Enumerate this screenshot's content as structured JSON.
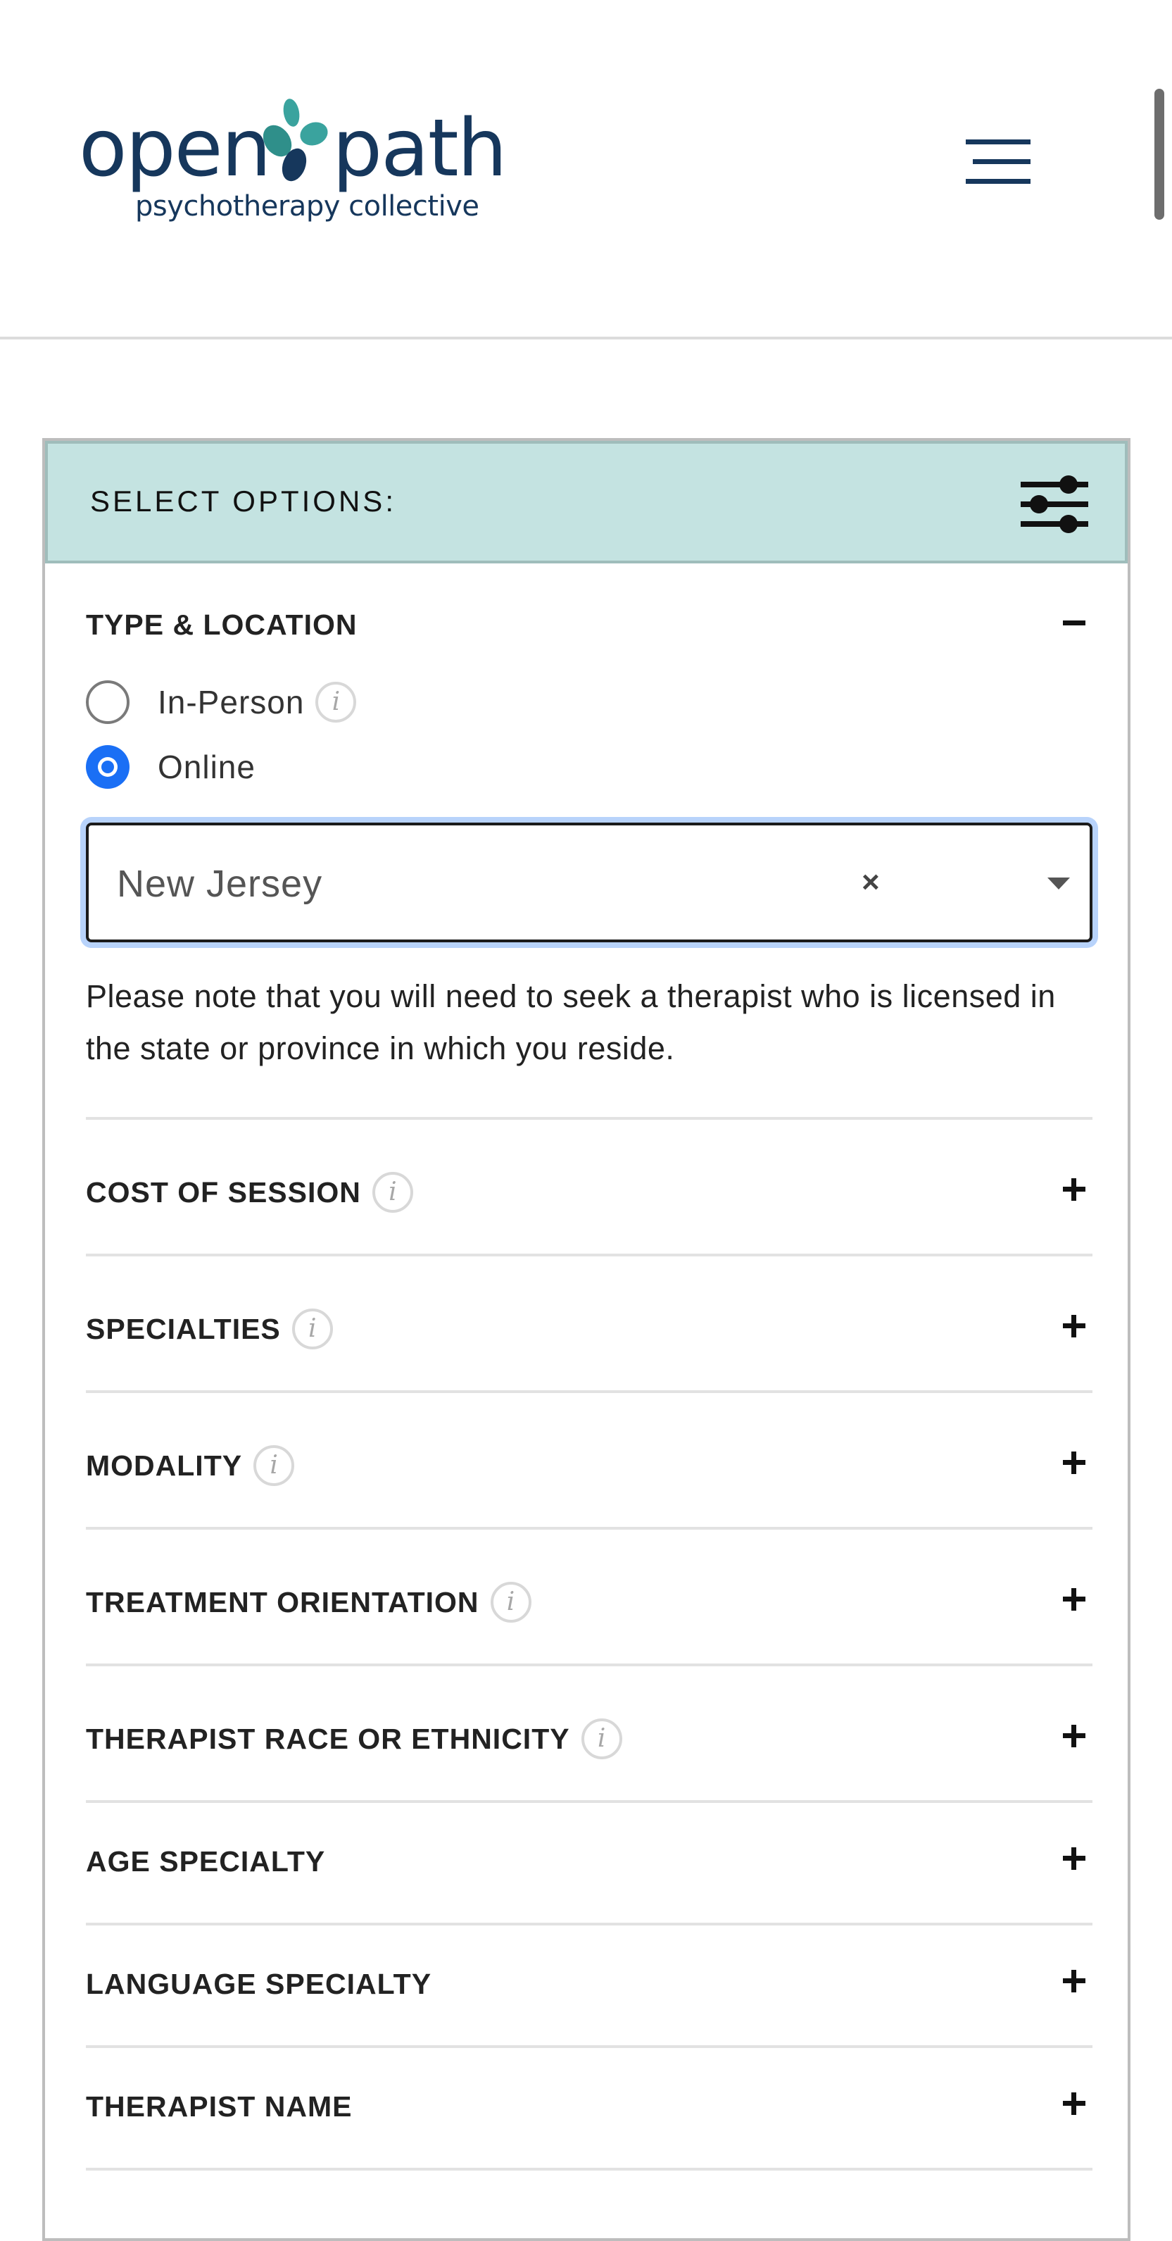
{
  "logo": {
    "word_left": "open",
    "word_right": "path",
    "tagline": "psychotherapy collective"
  },
  "colors": {
    "brand_navy": "#16375c",
    "brand_teal": "#3aa39e",
    "panel_header_bg": "#c4e3e1",
    "radio_checked": "#1a6ff5"
  },
  "header": {
    "menu_icon": "hamburger-menu-icon"
  },
  "filters": {
    "title": "SELECT OPTIONS:",
    "settings_icon": "sliders-icon",
    "type_location": {
      "heading": "TYPE & LOCATION",
      "options": [
        {
          "label": "In-Person",
          "checked": false,
          "has_info": true
        },
        {
          "label": "Online",
          "checked": true,
          "has_info": false
        }
      ],
      "state_select": {
        "value": "New Jersey",
        "clear_label": "×"
      },
      "note": "Please note that you will need to seek a therapist who is licensed in the state or province in which you reside."
    },
    "sections": [
      {
        "heading": "COST OF SESSION",
        "has_info": true
      },
      {
        "heading": "SPECIALTIES",
        "has_info": true
      },
      {
        "heading": "MODALITY",
        "has_info": true
      },
      {
        "heading": "TREATMENT ORIENTATION",
        "has_info": true
      },
      {
        "heading": "THERAPIST RACE OR ETHNICITY",
        "has_info": true
      },
      {
        "heading": "AGE SPECIALTY",
        "has_info": false
      },
      {
        "heading": "LANGUAGE SPECIALTY",
        "has_info": false
      },
      {
        "heading": "THERAPIST NAME",
        "has_info": false
      }
    ],
    "info_glyph": "i"
  }
}
